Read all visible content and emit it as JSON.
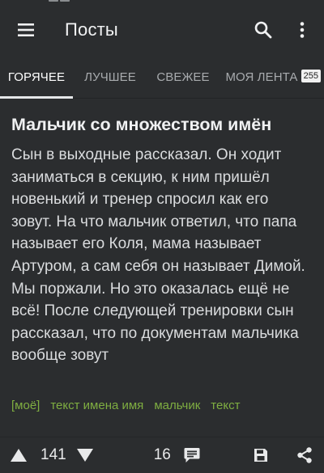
{
  "appbar": {
    "title": "Посты",
    "icons": [
      "menu-icon",
      "search-icon",
      "more-vertical-icon"
    ]
  },
  "tabs": [
    {
      "label": "ГОРЯЧЕЕ",
      "active": true
    },
    {
      "label": "ЛУЧШЕЕ",
      "active": false
    },
    {
      "label": "СВЕЖЕЕ",
      "active": false
    },
    {
      "label": "МОЯ ЛЕНТА",
      "active": false,
      "badge": "255"
    }
  ],
  "post": {
    "title": "Мальчик со множеством имён",
    "body": "Сын в выходные рассказал. Он ходит заниматься в секцию, к ним пришёл новенький и тренер спросил как его зовут. На что мальчик ответил, что папа называет его Коля, мама называет Артуром, а сам себя он называет Димой. Мы поржали. Но это оказалась ещё не всё! После следующей тренировки сын рассказал, что по документам мальчика вообще зовут",
    "tags": [
      "[моё]",
      "текст имена имя",
      "мальчик",
      "текст"
    ],
    "rating": "141",
    "comments": "16"
  },
  "colors": {
    "background": "#2b2d2f",
    "tag": "#7fae41",
    "text": "#dadcde"
  }
}
